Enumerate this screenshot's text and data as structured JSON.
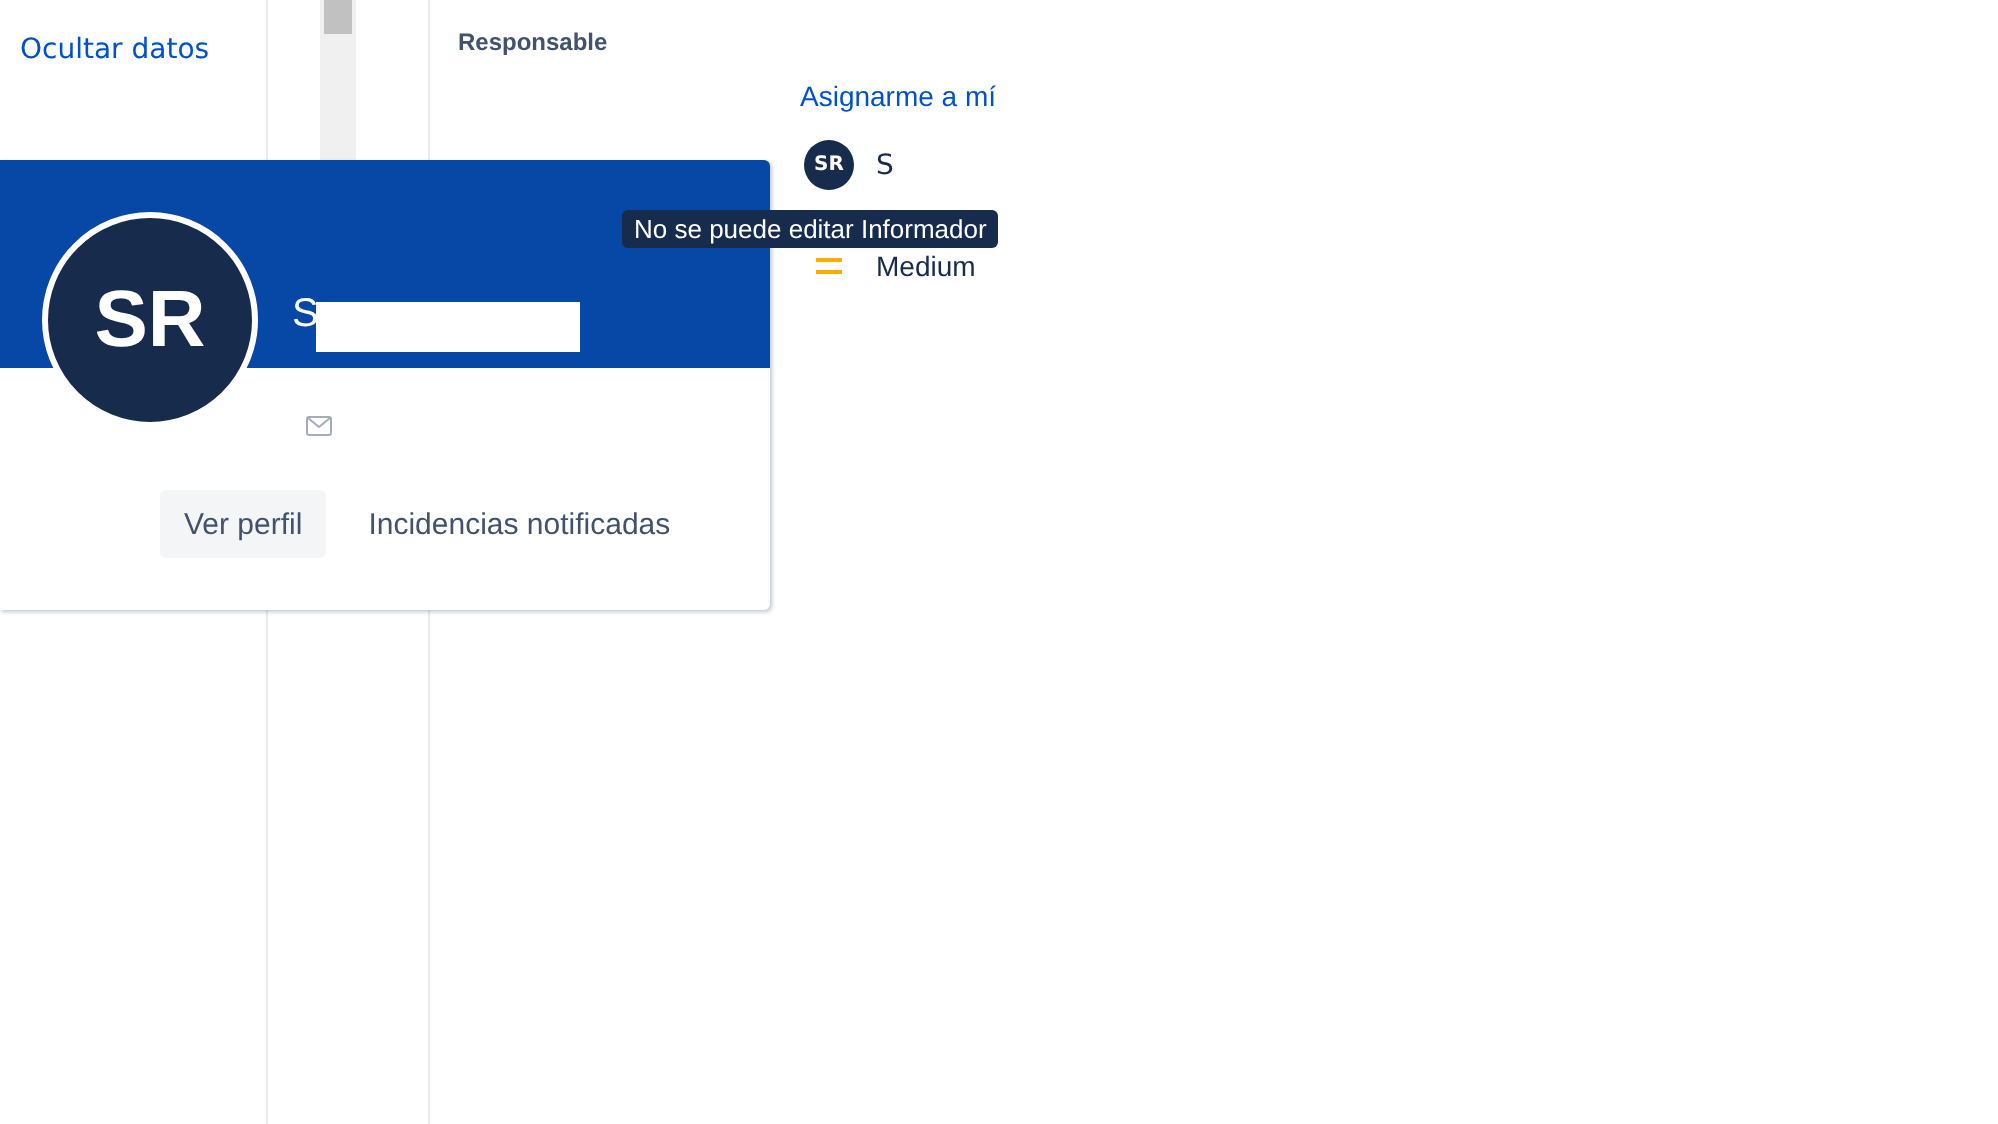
{
  "sidebar": {
    "link": "Ocultar datos"
  },
  "details": {
    "assignee_label": "Responsable",
    "assign_link": "Asignarme a mí",
    "reporter": {
      "initials": "SR",
      "name": "S"
    },
    "priority": {
      "label": "Medium",
      "color": "#ffab00"
    }
  },
  "tooltip": "No se puede editar Informador",
  "profile_card": {
    "initials": "SR",
    "name": "S",
    "actions": [
      {
        "label": "Ver perfil",
        "kind": "filled"
      },
      {
        "label": "Incidencias notificadas",
        "kind": "plain"
      }
    ]
  }
}
